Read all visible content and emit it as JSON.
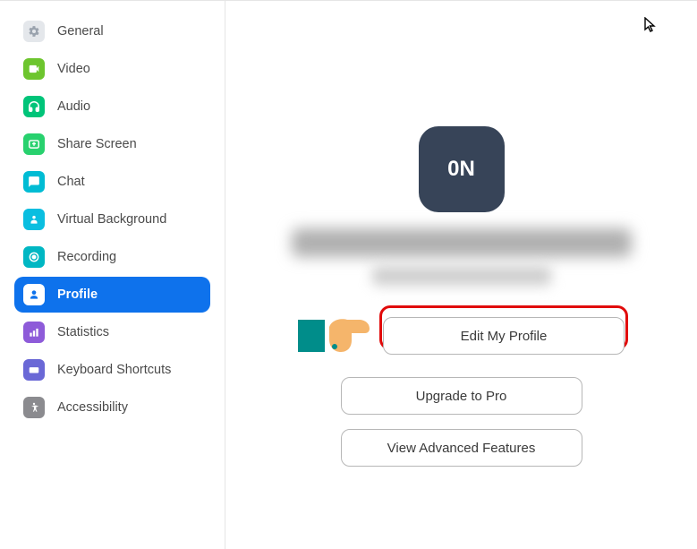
{
  "sidebar": {
    "items": [
      {
        "label": "General"
      },
      {
        "label": "Video"
      },
      {
        "label": "Audio"
      },
      {
        "label": "Share Screen"
      },
      {
        "label": "Chat"
      },
      {
        "label": "Virtual Background"
      },
      {
        "label": "Recording"
      },
      {
        "label": "Profile"
      },
      {
        "label": "Statistics"
      },
      {
        "label": "Keyboard Shortcuts"
      },
      {
        "label": "Accessibility"
      }
    ]
  },
  "profile": {
    "avatar_initials": "0N",
    "buttons": {
      "edit": "Edit My Profile",
      "upgrade": "Upgrade to Pro",
      "advanced": "View Advanced Features"
    }
  }
}
